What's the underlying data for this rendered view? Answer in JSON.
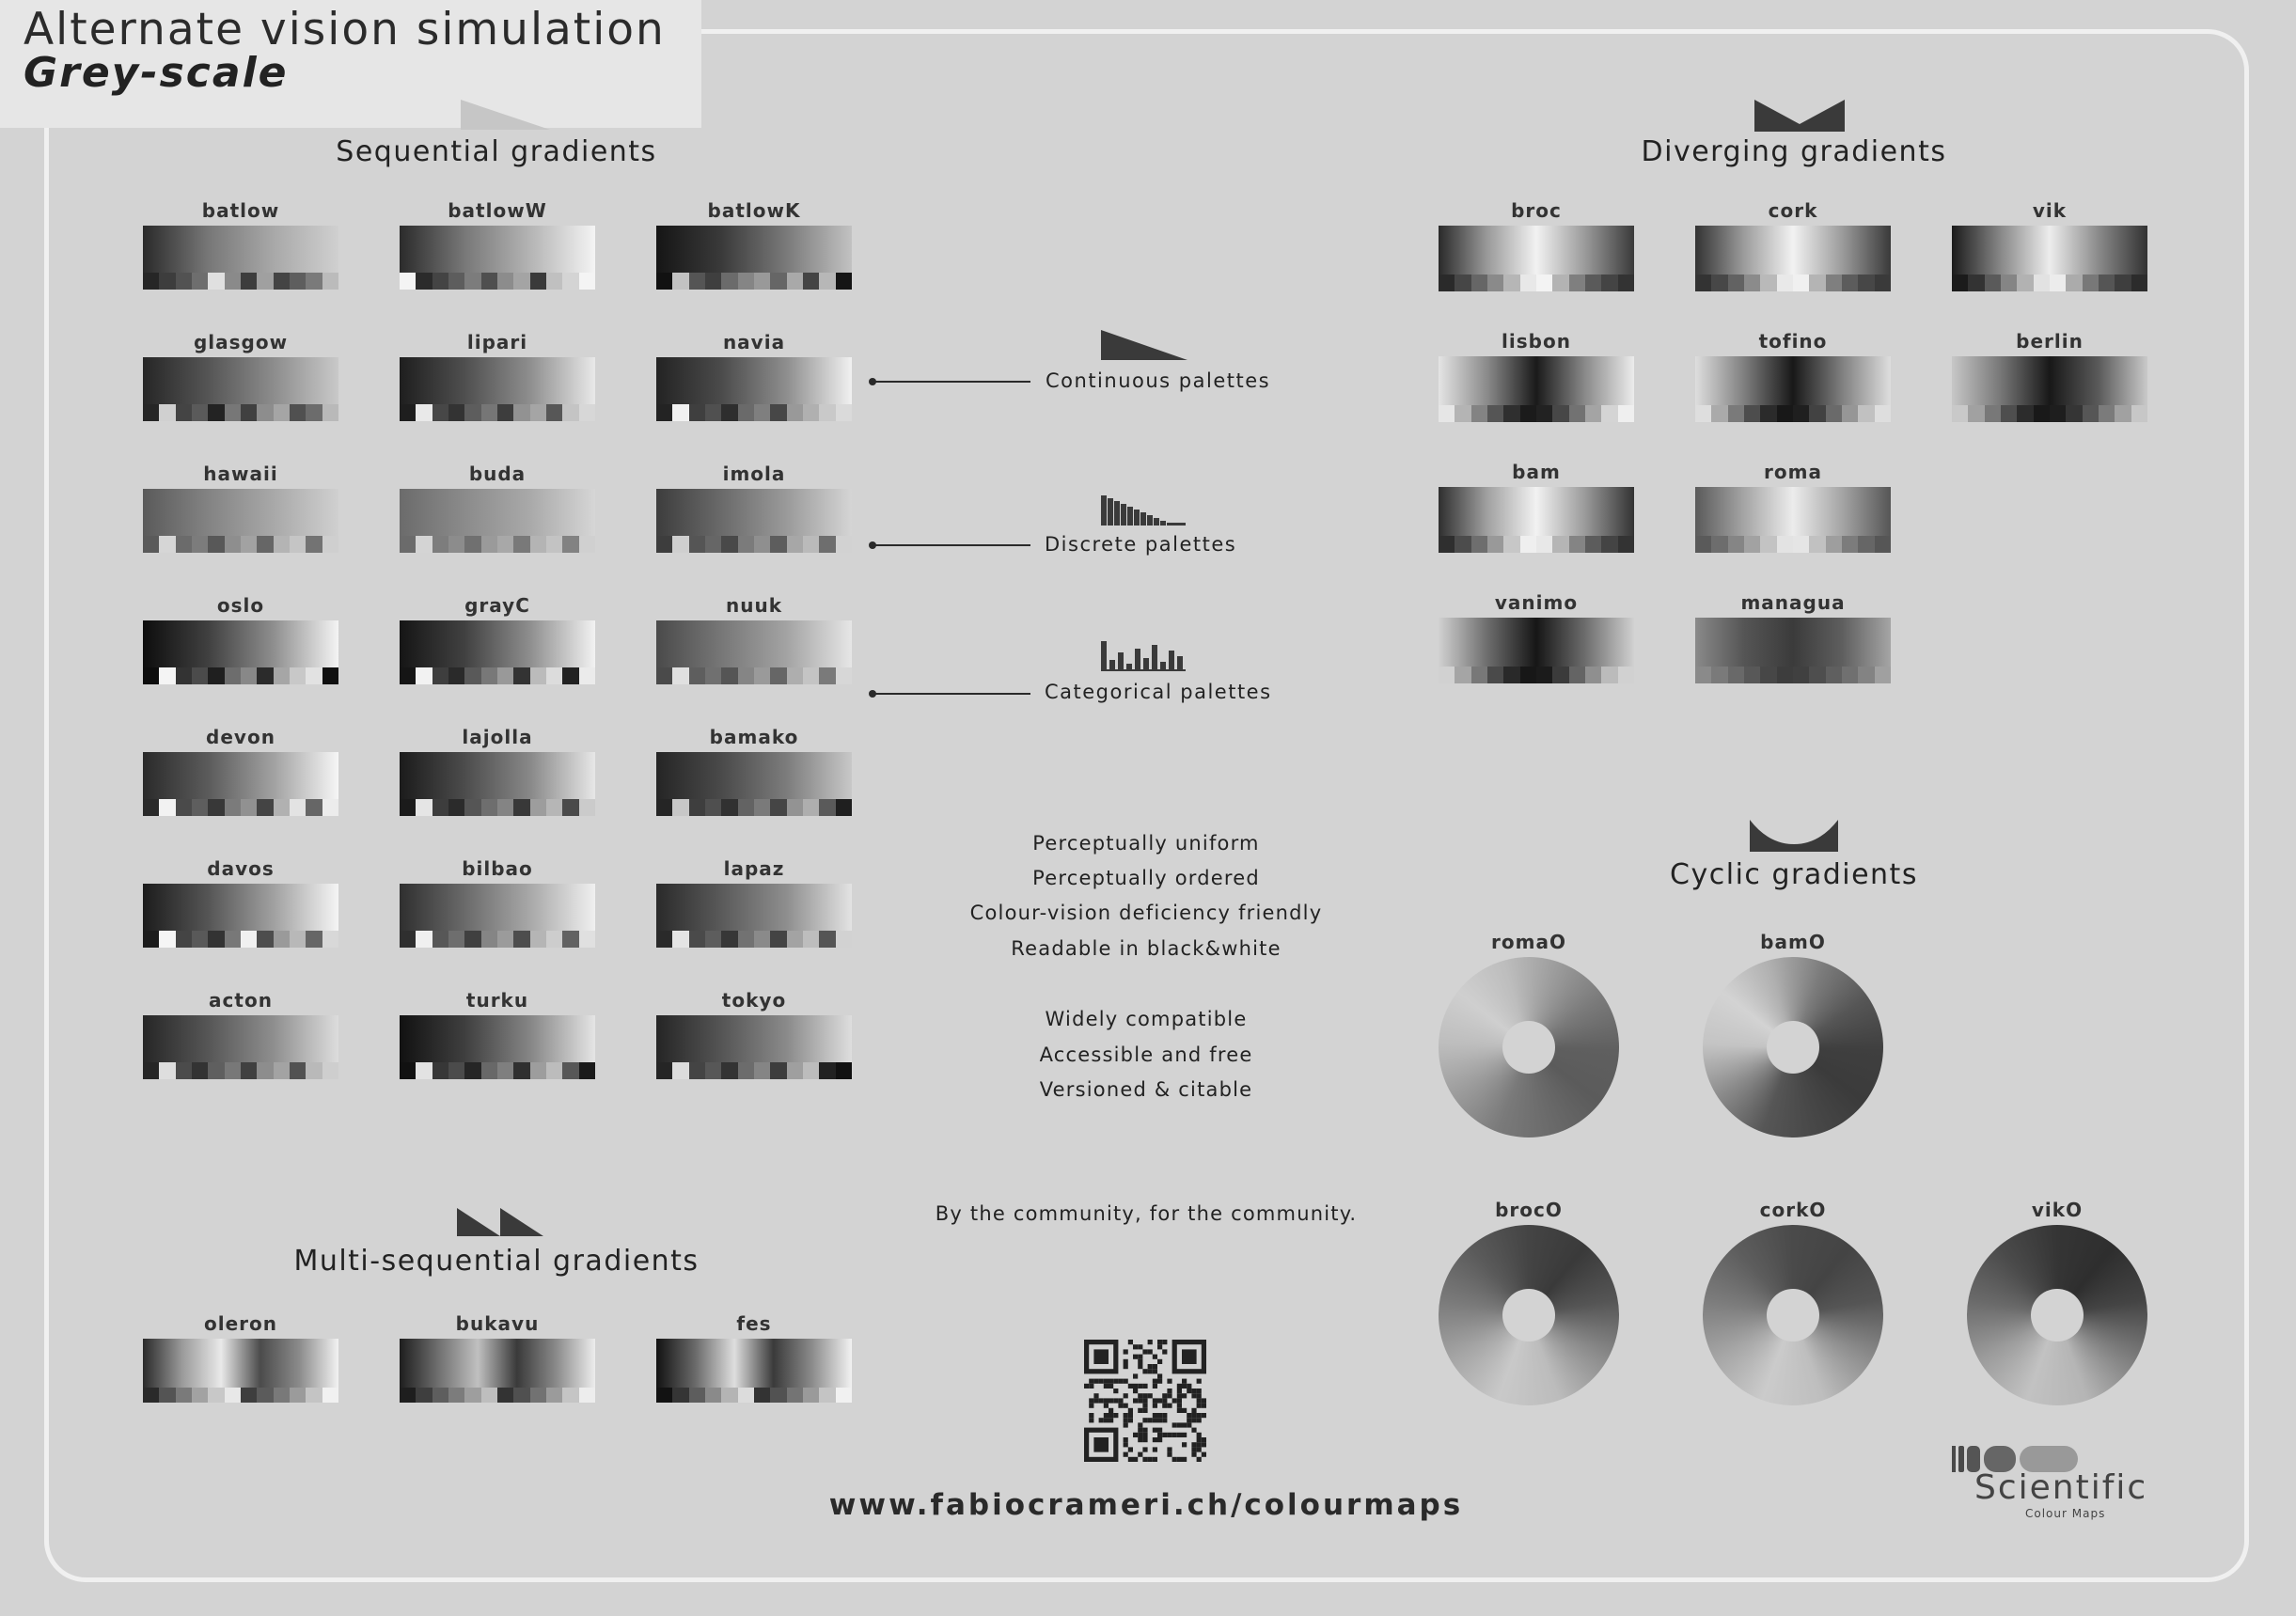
{
  "header": {
    "line1": "Alternate vision simulation",
    "line2": "Grey-scale"
  },
  "sections": {
    "sequential": "Sequential gradients",
    "diverging": "Diverging gradients",
    "multi": "Multi-sequential gradients",
    "cyclic": "Cyclic gradients"
  },
  "sequential_maps": [
    {
      "name": "batlow",
      "g": [
        "#2a2a2a",
        "#777",
        "#a8a8a8",
        "#d0d0d0"
      ],
      "s": [
        "#262626",
        "#3d3d3d",
        "#525252",
        "#6e6e6e",
        "#e0e0e0",
        "#8a8a8a",
        "#3d3d3d",
        "#a0a0a0",
        "#444",
        "#5e5e5e",
        "#7a7a7a",
        "#bbb"
      ]
    },
    {
      "name": "batlowW",
      "g": [
        "#2b2b2b",
        "#787878",
        "#b4b4b4",
        "#f4f4f4"
      ],
      "s": [
        "#f4f4f4",
        "#2b2b2b",
        "#444",
        "#5d5d5d",
        "#7c7c7c",
        "#4f4f4f",
        "#8c8c8c",
        "#a4a4a4",
        "#3a3a3a",
        "#c0c0c0",
        "#d4d4d4",
        "#f4f4f4"
      ]
    },
    {
      "name": "batlowK",
      "g": [
        "#151515",
        "#3a3a3a",
        "#7a7a7a",
        "#c2c2c2"
      ],
      "s": [
        "#111",
        "#c2c2c2",
        "#555",
        "#3f3f3f",
        "#6b6b6b",
        "#858585",
        "#999",
        "#666",
        "#a9a9a9",
        "#444",
        "#b7b7b7",
        "#151515"
      ]
    },
    {
      "name": "glasgow",
      "g": [
        "#262626",
        "#555",
        "#8c8c8c",
        "#c9c9c9"
      ],
      "s": [
        "#262626",
        "#d0d0d0",
        "#444",
        "#5a5a5a",
        "#232323",
        "#777",
        "#404040",
        "#8d8d8d",
        "#a5a5a5",
        "#505050",
        "#6c6c6c",
        "#b9b9b9"
      ]
    },
    {
      "name": "lipari",
      "g": [
        "#1e1e1e",
        "#4f4f4f",
        "#8e8e8e",
        "#e9e9e9"
      ],
      "s": [
        "#1e1e1e",
        "#e9e9e9",
        "#474747",
        "#333",
        "#5d5d5d",
        "#767676",
        "#3d3d3d",
        "#929292",
        "#a5a5a5",
        "#575757",
        "#c4c4c4",
        "#d7d7d7"
      ]
    },
    {
      "name": "navia",
      "g": [
        "#232323",
        "#4b4b4b",
        "#8e8e8e",
        "#f1f1f1"
      ],
      "s": [
        "#232323",
        "#f1f1f1",
        "#3f3f3f",
        "#505050",
        "#2e2e2e",
        "#6a6a6a",
        "#7f7f7f",
        "#474747",
        "#999",
        "#b0b0b0",
        "#c9c9c9",
        "#dadada"
      ]
    },
    {
      "name": "hawaii",
      "g": [
        "#5a5a5a",
        "#838383",
        "#a8a8a8",
        "#d0d0d0"
      ],
      "s": [
        "#5a5a5a",
        "#d6d6d6",
        "#6b6b6b",
        "#7c7c7c",
        "#585858",
        "#8e8e8e",
        "#a2a2a2",
        "#666",
        "#b4b4b4",
        "#c5c5c5",
        "#737373",
        "#cfcfcf"
      ]
    },
    {
      "name": "buda",
      "g": [
        "#6b6b6b",
        "#8b8b8b",
        "#a9a9a9",
        "#d6d6d6"
      ],
      "s": [
        "#6b6b6b",
        "#d4d4d4",
        "#7d7d7d",
        "#8c8c8c",
        "#707070",
        "#9a9a9a",
        "#a8a8a8",
        "#797979",
        "#b4b4b4",
        "#c3c3c3",
        "#828282",
        "#d0d0d0"
      ]
    },
    {
      "name": "imola",
      "g": [
        "#3d3d3d",
        "#6a6a6a",
        "#9a9a9a",
        "#d5d5d5"
      ],
      "s": [
        "#3d3d3d",
        "#cfcfcf",
        "#555",
        "#666",
        "#494949",
        "#7b7b7b",
        "#8f8f8f",
        "#5d5d5d",
        "#a7a7a7",
        "#bababa",
        "#6e6e6e",
        "#d2d2d2"
      ]
    },
    {
      "name": "oslo",
      "g": [
        "#0d0d0d",
        "#404040",
        "#8e8e8e",
        "#f4f4f4"
      ],
      "s": [
        "#0d0d0d",
        "#f4f4f4",
        "#333",
        "#4b4b4b",
        "#1f1f1f",
        "#6d6d6d",
        "#888",
        "#2b2b2b",
        "#a6a6a6",
        "#c8c8c8",
        "#e2e2e2",
        "#101010"
      ]
    },
    {
      "name": "grayC",
      "g": [
        "#151515",
        "#414141",
        "#8e8e8e",
        "#f2f2f2"
      ],
      "s": [
        "#151515",
        "#f2f2f2",
        "#3e3e3e",
        "#2a2a2a",
        "#595959",
        "#787878",
        "#999",
        "#333",
        "#bbb",
        "#dcdcdc",
        "#222",
        "#ebebeb"
      ]
    },
    {
      "name": "nuuk",
      "g": [
        "#4a4a4a",
        "#777",
        "#a3a3a3",
        "#e6e6e6"
      ],
      "s": [
        "#4a4a4a",
        "#e0e0e0",
        "#5e5e5e",
        "#707070",
        "#555",
        "#858585",
        "#9a9a9a",
        "#666",
        "#aeaeae",
        "#c4c4c4",
        "#7a7a7a",
        "#d7d7d7"
      ]
    },
    {
      "name": "devon",
      "g": [
        "#2a2a2a",
        "#5b5b5b",
        "#a1a1a1",
        "#f6f6f6"
      ],
      "s": [
        "#2a2a2a",
        "#f2f2f2",
        "#4a4a4a",
        "#5e5e5e",
        "#383838",
        "#7b7b7b",
        "#919191",
        "#444",
        "#b1b1b1",
        "#e3e3e3",
        "#666",
        "#ececec"
      ]
    },
    {
      "name": "lajolla",
      "g": [
        "#1b1b1b",
        "#4c4c4c",
        "#888",
        "#e7e7e7"
      ],
      "s": [
        "#1b1b1b",
        "#e5e5e5",
        "#3d3d3d",
        "#2b2b2b",
        "#555",
        "#6e6e6e",
        "#848484",
        "#383838",
        "#9d9d9d",
        "#b6b6b6",
        "#4a4a4a",
        "#cbcbcb"
      ]
    },
    {
      "name": "bamako",
      "g": [
        "#252525",
        "#4a4a4a",
        "#7c7c7c",
        "#c8c8c8"
      ],
      "s": [
        "#252525",
        "#c7c7c7",
        "#3e3e3e",
        "#4f4f4f",
        "#313131",
        "#636363",
        "#7a7a7a",
        "#454545",
        "#939393",
        "#aeaeae",
        "#5a5a5a",
        "#1f1f1f"
      ]
    },
    {
      "name": "davos",
      "g": [
        "#1c1c1c",
        "#555",
        "#a0a0a0",
        "#f5f5f5"
      ],
      "s": [
        "#1c1c1c",
        "#f5f5f5",
        "#444",
        "#595959",
        "#333",
        "#787878",
        "#f0f0f0",
        "#4d4d4d",
        "#9a9a9a",
        "#b8b8b8",
        "#666",
        "#d8d8d8"
      ]
    },
    {
      "name": "bilbao",
      "g": [
        "#2f2f2f",
        "#6a6a6a",
        "#a8a8a8",
        "#f0f0f0"
      ],
      "s": [
        "#2f2f2f",
        "#f0f0f0",
        "#575757",
        "#6e6e6e",
        "#404040",
        "#858585",
        "#9b9b9b",
        "#4d4d4d",
        "#b5b5b5",
        "#cdcdcd",
        "#626262",
        "#e0e0e0"
      ]
    },
    {
      "name": "lapaz",
      "g": [
        "#2a2a2a",
        "#5a5a5a",
        "#8e8e8e",
        "#e3e3e3"
      ],
      "s": [
        "#2a2a2a",
        "#e4e4e4",
        "#4a4a4a",
        "#5d5d5d",
        "#373737",
        "#727272",
        "#8a8a8a",
        "#444",
        "#a3a3a3",
        "#bdbdbd",
        "#555",
        "#d2d2d2"
      ]
    },
    {
      "name": "acton",
      "g": [
        "#262626",
        "#565656",
        "#8e8e8e",
        "#dddddd"
      ],
      "s": [
        "#262626",
        "#dedede",
        "#4b4b4b",
        "#333",
        "#5f5f5f",
        "#787878",
        "#404040",
        "#8d8d8d",
        "#a3a3a3",
        "#525252",
        "#b9b9b9",
        "#cecece"
      ]
    },
    {
      "name": "turku",
      "g": [
        "#111",
        "#3f3f3f",
        "#858585",
        "#e5e5e5"
      ],
      "s": [
        "#111",
        "#e2e2e2",
        "#373737",
        "#4b4b4b",
        "#262626",
        "#686868",
        "#7f7f7f",
        "#303030",
        "#9d9d9d",
        "#bcbcbc",
        "#575757",
        "#1a1a1a"
      ]
    },
    {
      "name": "tokyo",
      "g": [
        "#252525",
        "#555",
        "#8a8a8a",
        "#dedede"
      ],
      "s": [
        "#252525",
        "#dcdcdc",
        "#444",
        "#575757",
        "#333",
        "#6c6c6c",
        "#858585",
        "#3d3d3d",
        "#9f9f9f",
        "#bcbcbc",
        "#222",
        "#111"
      ]
    }
  ],
  "diverging_maps": [
    {
      "name": "broc",
      "g": [
        "#2a2a2a",
        "#9a9a9a",
        "#f2f2f2",
        "#9a9a9a",
        "#3a3a3a"
      ],
      "s": [
        "#2a2a2a",
        "#464646",
        "#666",
        "#8a8a8a",
        "#b6b6b6",
        "#e8e8e8",
        "#f3f3f3",
        "#b3b3b3",
        "#7f7f7f",
        "#5a5a5a",
        "#444",
        "#333"
      ]
    },
    {
      "name": "cork",
      "g": [
        "#333",
        "#9c9c9c",
        "#f2f2f2",
        "#9c9c9c",
        "#3a3a3a"
      ],
      "s": [
        "#333",
        "#474747",
        "#626262",
        "#8b8b8b",
        "#b9b9b9",
        "#e9e9e9",
        "#f0f0f0",
        "#b4b4b4",
        "#7f7f7f",
        "#5c5c5c",
        "#474747",
        "#3a3a3a"
      ]
    },
    {
      "name": "vik",
      "g": [
        "#1b1b1b",
        "#888",
        "#ededed",
        "#8a8a8a",
        "#323232"
      ],
      "s": [
        "#1b1b1b",
        "#333",
        "#5a5a5a",
        "#858585",
        "#b2b2b2",
        "#e2e2e2",
        "#ececec",
        "#ababab",
        "#787878",
        "#555",
        "#3e3e3e",
        "#2c2c2c"
      ]
    },
    {
      "name": "lisbon",
      "g": [
        "#e4e4e4",
        "#8a8a8a",
        "#1a1a1a",
        "#8a8a8a",
        "#ececec"
      ],
      "s": [
        "#e6e6e6",
        "#b4b4b4",
        "#838383",
        "#555",
        "#2f2f2f",
        "#1b1b1b",
        "#222",
        "#474747",
        "#727272",
        "#a4a4a4",
        "#d4d4d4",
        "#efefef"
      ]
    },
    {
      "name": "tofino",
      "g": [
        "#dedede",
        "#7f7f7f",
        "#181818",
        "#7f7f7f",
        "#dedede"
      ],
      "s": [
        "#dedede",
        "#aaa",
        "#7a7a7a",
        "#4d4d4d",
        "#2b2b2b",
        "#181818",
        "#1f1f1f",
        "#424242",
        "#6a6a6a",
        "#969696",
        "#c1c1c1",
        "#dedede"
      ]
    },
    {
      "name": "berlin",
      "g": [
        "#c7c7c7",
        "#777",
        "#181818",
        "#5a5a5a",
        "#c9c9c9"
      ],
      "s": [
        "#c9c9c9",
        "#a1a1a1",
        "#787878",
        "#4e4e4e",
        "#2c2c2c",
        "#191919",
        "#1e1e1e",
        "#353535",
        "#565656",
        "#7b7b7b",
        "#a1a1a1",
        "#c7c7c7"
      ]
    },
    {
      "name": "bam",
      "g": [
        "#2f2f2f",
        "#a1a1a1",
        "#f2f2f2",
        "#9a9a9a",
        "#333"
      ],
      "s": [
        "#2f2f2f",
        "#4c4c4c",
        "#6e6e6e",
        "#999",
        "#c7c7c7",
        "#efefef",
        "#e8e8e8",
        "#b5b5b5",
        "#848484",
        "#5c5c5c",
        "#444",
        "#333"
      ]
    },
    {
      "name": "roma",
      "g": [
        "#5a5a5a",
        "#a5a5a5",
        "#ececec",
        "#a5a5a5",
        "#565656"
      ],
      "s": [
        "#5a5a5a",
        "#6d6d6d",
        "#858585",
        "#a2a2a2",
        "#c3c3c3",
        "#e3e3e3",
        "#e5e5e5",
        "#c1c1c1",
        "#9e9e9e",
        "#7c7c7c",
        "#666",
        "#565656"
      ]
    },
    {
      "name": "vanimo",
      "g": [
        "#d1d1d1",
        "#6d6d6d",
        "#161616",
        "#6d6d6d",
        "#d1d1d1"
      ],
      "s": [
        "#d1d1d1",
        "#a5a5a5",
        "#787878",
        "#4a4a4a",
        "#292929",
        "#171717",
        "#1b1b1b",
        "#3b3b3b",
        "#646464",
        "#8f8f8f",
        "#bbb",
        "#d1d1d1"
      ]
    },
    {
      "name": "managua",
      "g": [
        "#8a8a8a",
        "#555",
        "#3b3b3b",
        "#5e5e5e",
        "#a5a5a5"
      ],
      "s": [
        "#8a8a8a",
        "#7a7a7a",
        "#696969",
        "#585858",
        "#474747",
        "#3d3d3d",
        "#404040",
        "#4e4e4e",
        "#5f5f5f",
        "#707070",
        "#838383",
        "#a0a0a0"
      ]
    }
  ],
  "multi_maps": [
    {
      "name": "oleron",
      "g": [
        "#2a2a2a",
        "#9a9a9a",
        "#e9e9e9",
        "#4b4b4b",
        "#8b8b8b",
        "#f2f2f2"
      ],
      "s": [
        "#2a2a2a",
        "#545454",
        "#7a7a7a",
        "#a2a2a2",
        "#c8c8c8",
        "#e8e8e8",
        "#3e3e3e",
        "#5b5b5b",
        "#797979",
        "#9b9b9b",
        "#c4c4c4",
        "#f1f1f1"
      ]
    },
    {
      "name": "bukavu",
      "g": [
        "#1e1e1e",
        "#707070",
        "#c0c0c0",
        "#3a3a3a",
        "#8a8a8a",
        "#ededed"
      ],
      "s": [
        "#1e1e1e",
        "#3e3e3e",
        "#5e5e5e",
        "#7c7c7c",
        "#9e9e9e",
        "#bebebe",
        "#333",
        "#505050",
        "#727272",
        "#9b9b9b",
        "#c5c5c5",
        "#ededed"
      ]
    },
    {
      "name": "fes",
      "g": [
        "#121212",
        "#6a6a6a",
        "#dedede",
        "#3a3a3a",
        "#8d8d8d",
        "#f2f2f2"
      ],
      "s": [
        "#121212",
        "#353535",
        "#5d5d5d",
        "#8a8a8a",
        "#b4b4b4",
        "#dcdcdc",
        "#333",
        "#525252",
        "#747474",
        "#9a9a9a",
        "#c4c4c4",
        "#f1f1f1"
      ]
    }
  ],
  "cyclic_maps": [
    {
      "name": "romaO",
      "g": "conic-gradient(from 200deg,#7a7a7a,#9b9b9b,#bdbdbd,#cfcfcf,#bdbdbd,#9b9b9b,#7a7a7a,#5f5f5f,#5b5b5b,#6a6a6a,#7a7a7a)"
    },
    {
      "name": "bamO",
      "g": "conic-gradient(from 200deg,#565656,#8a8a8a,#c4c4c4,#d3d3d3,#b0b0b0,#7c7c7c,#565656,#3f3f3f,#3b3b3b,#474747,#565656)"
    },
    {
      "name": "brocO",
      "g": "conic-gradient(from 0deg,#444,#3a3a3a,#555,#8c8c8c,#bcbcbc,#c9c9c9,#a5a5a5,#7a7a7a,#5a5a5a,#444)"
    },
    {
      "name": "corkO",
      "g": "conic-gradient(from 0deg,#4a4a4a,#444,#555,#8d8d8d,#bebebe,#cbcbcb,#a6a6a6,#7c7c7c,#5d5d5d,#4a4a4a)"
    },
    {
      "name": "vikO",
      "g": "conic-gradient(from 0deg,#353535,#2e2e2e,#444,#7d7d7d,#b5b5b5,#c2c2c2,#9b9b9b,#6a6a6a,#4a4a4a,#353535)"
    }
  ],
  "palette_types": {
    "continuous": "Continuous palettes",
    "discrete": "Discrete palettes",
    "categorical": "Categorical palettes"
  },
  "features": [
    "Perceptually uniform",
    "Perceptually ordered",
    "Colour-vision deficiency friendly",
    "Readable in black&white",
    "Widely compatible",
    "Accessible and free",
    "Versioned & citable"
  ],
  "community": "By the community, for the community.",
  "url": "www.fabiocrameri.ch/colourmaps",
  "logo": {
    "word": "Scientific",
    "sub": "Colour Maps"
  },
  "icons": {
    "continuous": "ramp-triangle-icon",
    "discrete": "stepped-bars-icon",
    "categorical": "random-bars-icon",
    "sequential": "ramp-icon",
    "diverging": "diverging-wedge-icon",
    "multi": "double-ramp-icon",
    "cyclic": "cyclic-valley-icon",
    "qr": "qr-code-icon"
  }
}
